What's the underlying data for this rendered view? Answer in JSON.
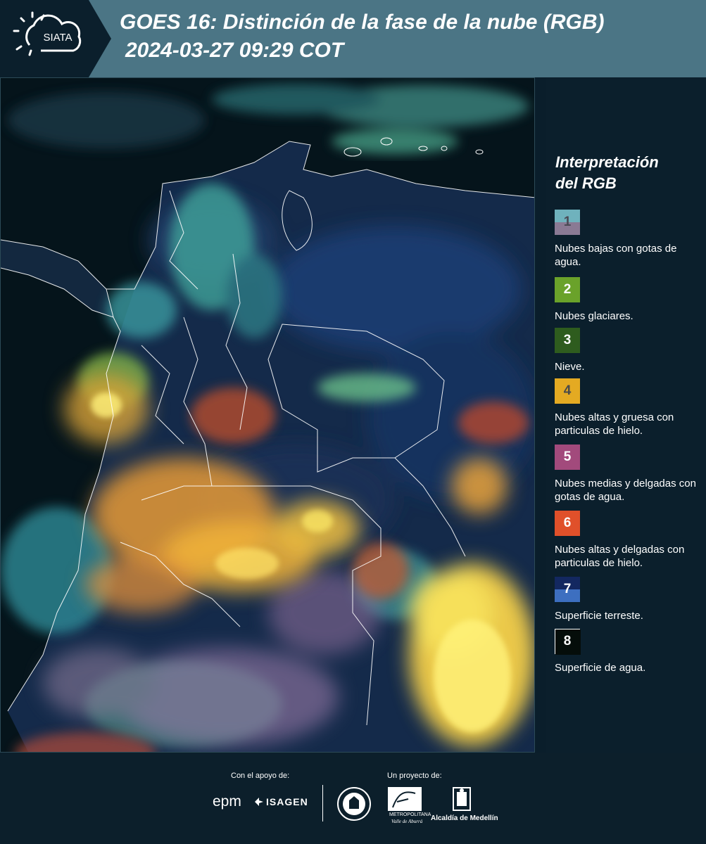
{
  "header": {
    "logo_text": "SIATA",
    "title": "GOES 16: Distinción de la fase de la nube (RGB)",
    "subtitle": "2024-03-27 09:29 COT"
  },
  "legend": {
    "title_line1": "Interpretación",
    "title_line2": "del RGB",
    "items": [
      {
        "number": "1",
        "label": "Nubes bajas con gotas de agua.",
        "color_top": "#6fb2bd",
        "color_bottom": "#8a7a94",
        "text_color": "#4a4a55"
      },
      {
        "number": "2",
        "label": "Nubes glaciares.",
        "color_top": "#6aa22a",
        "color_bottom": "#6aa22a",
        "text_color": "#ffffff"
      },
      {
        "number": "3",
        "label": "Nieve.",
        "color_top": "#2e5c1e",
        "color_bottom": "#2e5c1e",
        "text_color": "#ffffff"
      },
      {
        "number": "4",
        "label": "Nubes altas y gruesa con particulas de hielo.",
        "color_top": "#e4aa22",
        "color_bottom": "#e4aa22",
        "text_color": "#4a4a4a"
      },
      {
        "number": "5",
        "label": "Nubes medias y delgadas con gotas de agua.",
        "color_top": "#a24a7c",
        "color_bottom": "#a24a7c",
        "text_color": "#ffffff"
      },
      {
        "number": "6",
        "label": "Nubes altas y delgadas con particulas de hielo.",
        "color_top": "#e0502a",
        "color_bottom": "#e0502a",
        "text_color": "#ffffff"
      },
      {
        "number": "7",
        "label": "Superficie terreste.",
        "color_top": "#132860",
        "color_bottom": "#3d6fc0",
        "text_color": "#ffffff"
      },
      {
        "number": "8",
        "label": "Superficie de agua.",
        "color_top": "#050d0a",
        "color_bottom": "#050d0a",
        "text_color": "#ffffff"
      }
    ]
  },
  "footer": {
    "support_label": "Con el apoyo de:",
    "project_label": "Un proyecto de:",
    "epm": "epm",
    "isagen": "ISAGEN",
    "amva_line1": "METROPOLITANA",
    "amva_line2": "Valle de Aburrá",
    "medellin": "Alcaldía de Medellín"
  },
  "colors": {
    "header_bg": "#4b7585",
    "panel_bg": "#0b1f2c",
    "ocean": "#05141b",
    "land": "#142a4a"
  }
}
